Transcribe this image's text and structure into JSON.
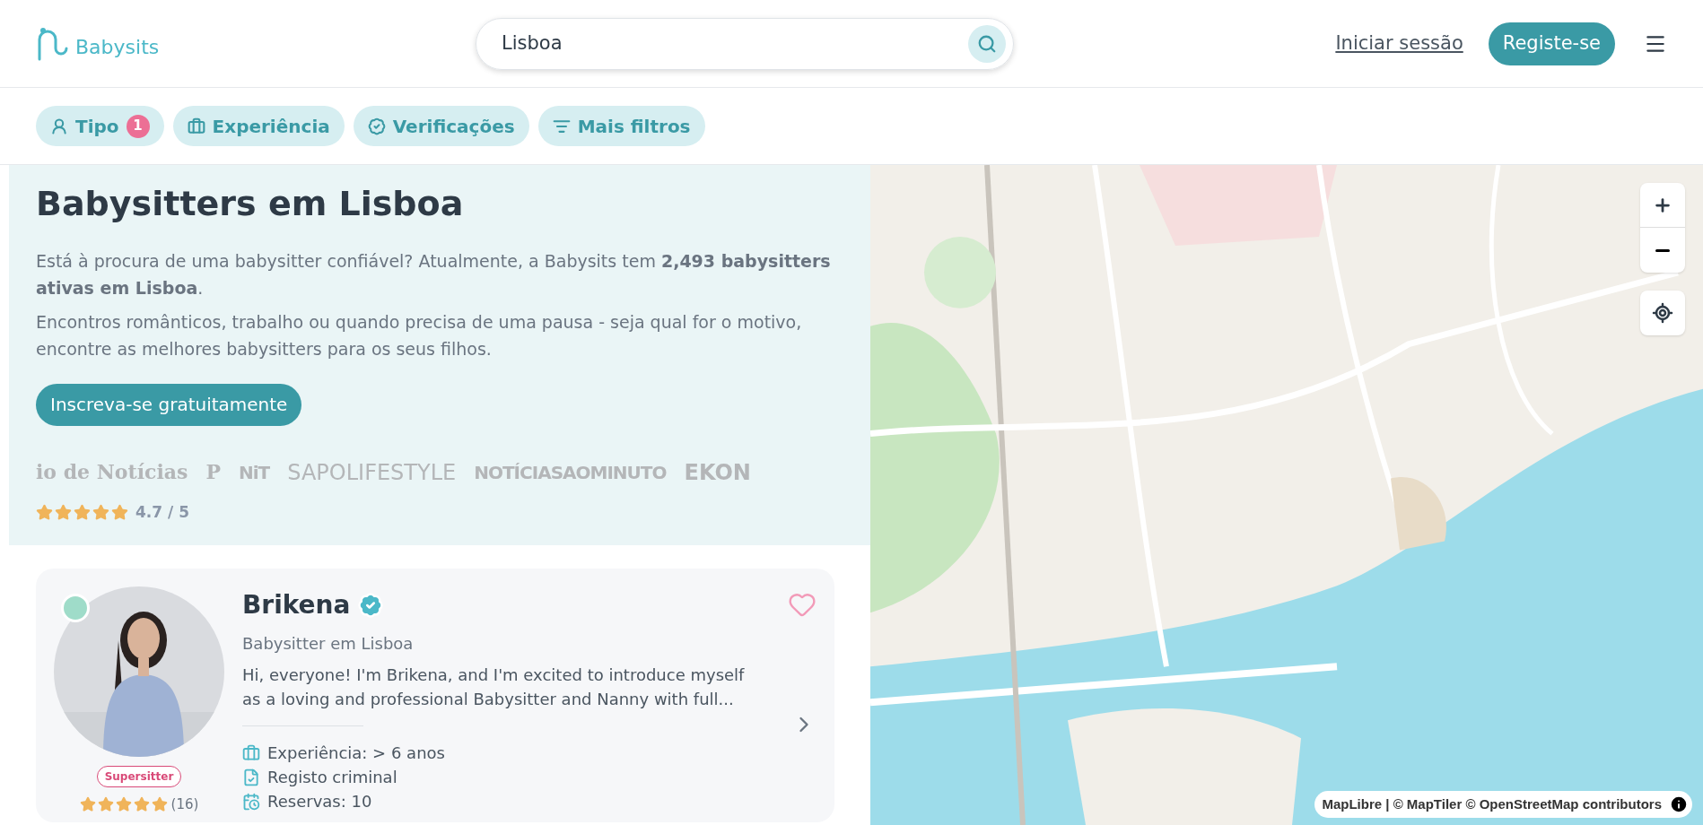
{
  "header": {
    "logo": "Babysits",
    "search": {
      "value": "Lisboa"
    },
    "login": "Iniciar sessão",
    "signup": "Registe-se"
  },
  "filters": [
    {
      "label": "Tipo",
      "kind": "type",
      "count": "1"
    },
    {
      "label": "Experiência",
      "kind": "experience"
    },
    {
      "label": "Verificações",
      "kind": "verification"
    },
    {
      "label": "Mais filtros",
      "kind": "more"
    }
  ],
  "hero": {
    "title": "Babysitters em Lisboa",
    "paragraphs": [
      "Está à procura de uma babysitter confiável? Atualmente, a Babysits tem **2,493 babysitters ativas em Lisboa**.",
      "Encontros românticos, trabalho ou quando precisa de uma pausa - seja qual for o motivo, encontre as melhores babysitters para os seus filhos."
    ],
    "cta": "Inscreva-se gratuitamente",
    "press": [
      {
        "text": "io de Notícias",
        "kind": "blackletter"
      },
      {
        "text": "P",
        "kind": "blackletter"
      },
      {
        "text": "NiT",
        "kind": "heavy"
      },
      {
        "text": "SAPOLIFESTYLE",
        "kind": "sans"
      },
      {
        "text": "NOTÍCIASAOMINUTO",
        "kind": "heavy"
      },
      {
        "text": "EKON",
        "kind": "menu"
      }
    ],
    "rating": {
      "stars": 5,
      "score": "4.7 / 5"
    }
  },
  "profiles": [
    {
      "name": "Brikena",
      "verified": true,
      "online": true,
      "favorite": false,
      "subtitle": "Babysitter em Lisboa",
      "bio": "Hi, everyone! I'm Brikena, and I'm excited to introduce myself as a loving and professional Babysitter and Nanny with full...",
      "badge": "Supersitter",
      "stars": 5,
      "reviews": "(16)",
      "facts": [
        {
          "kind": "experience",
          "text": "Experiência: > 6 anos"
        },
        {
          "kind": "criminal",
          "text": "Registo criminal"
        },
        {
          "kind": "bookings",
          "text": "Reservas: 10"
        }
      ]
    }
  ],
  "map": {
    "kind": "picture",
    "attribution": "MapLibre | © MapTiler © OpenStreetMap contributors"
  }
}
